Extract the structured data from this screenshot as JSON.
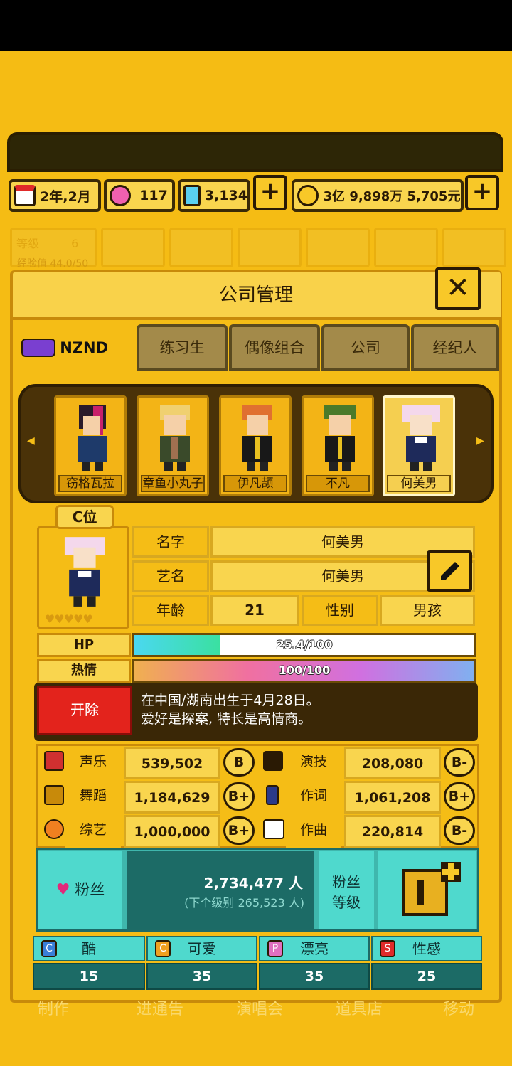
{
  "resources": {
    "date": "2年,2月",
    "pink_gems": "117",
    "blue_gems": "3,134",
    "money": "3亿 9,898万 5,705元"
  },
  "background": {
    "level_label": "等级",
    "level_value": "6",
    "exp_label": "经验值 44.0/50",
    "bottom_menu": [
      "制作",
      "进通告",
      "演唱会",
      "道具店",
      "移动"
    ]
  },
  "dialog": {
    "title": "公司管理",
    "tabs": [
      "NZND",
      "练习生",
      "偶像组合",
      "公司",
      "经纪人"
    ]
  },
  "roster": [
    {
      "name": "窃格瓦拉"
    },
    {
      "name": "章鱼小丸子"
    },
    {
      "name": "伊凡颉"
    },
    {
      "name": "不凡"
    },
    {
      "name": "何美男"
    }
  ],
  "profile": {
    "position_badge": "C位",
    "name_label": "名字",
    "name_value": "何美男",
    "stage_label": "艺名",
    "stage_value": "何美男",
    "age_label": "年龄",
    "age_value": "21",
    "gender_label": "性别",
    "gender_value": "男孩",
    "hp_label": "HP",
    "hp_text": "25.4/100",
    "hp_fraction": 0.254,
    "passion_label": "热情",
    "passion_text": "100/100",
    "passion_fraction": 1.0,
    "fire_button": "开除",
    "bio_line1": "在中国/湖南出生于4月28日。",
    "bio_line2": "爱好是探案, 特长是高情商。"
  },
  "stats": [
    {
      "label": "声乐",
      "value": "539,502",
      "grade": "B",
      "icon": "microphone-icon"
    },
    {
      "label": "演技",
      "value": "208,080",
      "grade": "B-",
      "icon": "camera-icon"
    },
    {
      "label": "舞蹈",
      "value": "1,184,629",
      "grade": "B+",
      "icon": "shoe-icon"
    },
    {
      "label": "作词",
      "value": "1,061,208",
      "grade": "B+",
      "icon": "pen-icon"
    },
    {
      "label": "综艺",
      "value": "1,000,000",
      "grade": "B+",
      "icon": "mask-icon"
    },
    {
      "label": "作曲",
      "value": "220,814",
      "grade": "B-",
      "icon": "keyboard-icon"
    }
  ],
  "fans": {
    "label": "粉丝",
    "count": "2,734,477 人",
    "next": "(下个级别 265,523 人)",
    "level_label_1": "粉丝",
    "level_label_2": "等级"
  },
  "attributes": [
    {
      "label": "酷",
      "value": "15",
      "letter": "C",
      "color": "#3a7fd8"
    },
    {
      "label": "可爱",
      "value": "35",
      "letter": "C",
      "color": "#f0a020"
    },
    {
      "label": "漂亮",
      "value": "35",
      "letter": "P",
      "color": "#e070c0"
    },
    {
      "label": "性感",
      "value": "25",
      "letter": "S",
      "color": "#e02a2a"
    }
  ]
}
